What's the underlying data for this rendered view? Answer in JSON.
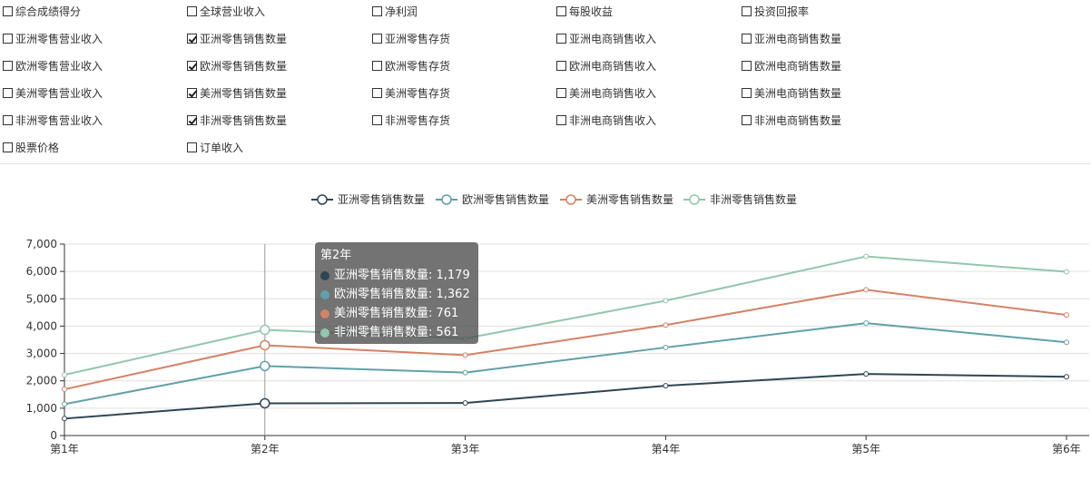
{
  "checkbox_rows": [
    [
      {
        "label": "综合成绩得分",
        "checked": false
      },
      {
        "label": "全球营业收入",
        "checked": false
      },
      {
        "label": "净利润",
        "checked": false
      },
      {
        "label": "每股收益",
        "checked": false
      },
      {
        "label": "投资回报率",
        "checked": false
      }
    ],
    [
      {
        "label": "亚洲零售营业收入",
        "checked": false
      },
      {
        "label": "亚洲零售销售数量",
        "checked": true
      },
      {
        "label": "亚洲零售存货",
        "checked": false
      },
      {
        "label": "亚洲电商销售收入",
        "checked": false
      },
      {
        "label": "亚洲电商销售数量",
        "checked": false
      }
    ],
    [
      {
        "label": "欧洲零售营业收入",
        "checked": false
      },
      {
        "label": "欧洲零售销售数量",
        "checked": true
      },
      {
        "label": "欧洲零售存货",
        "checked": false
      },
      {
        "label": "欧洲电商销售收入",
        "checked": false
      },
      {
        "label": "欧洲电商销售数量",
        "checked": false
      }
    ],
    [
      {
        "label": "美洲零售营业收入",
        "checked": false
      },
      {
        "label": "美洲零售销售数量",
        "checked": true
      },
      {
        "label": "美洲零售存货",
        "checked": false
      },
      {
        "label": "美洲电商销售收入",
        "checked": false
      },
      {
        "label": "美洲电商销售数量",
        "checked": false
      }
    ],
    [
      {
        "label": "非洲零售营业收入",
        "checked": false
      },
      {
        "label": "非洲零售销售数量",
        "checked": true
      },
      {
        "label": "非洲零售存货",
        "checked": false
      },
      {
        "label": "非洲电商销售收入",
        "checked": false
      },
      {
        "label": "非洲电商销售数量",
        "checked": false
      }
    ],
    [
      {
        "label": "股票价格",
        "checked": false
      },
      {
        "label": "订单收入",
        "checked": false
      }
    ]
  ],
  "chart_data": {
    "type": "line",
    "stacked": true,
    "categories": [
      "第1年",
      "第2年",
      "第3年",
      "第4年",
      "第5年",
      "第6年"
    ],
    "series": [
      {
        "name": "亚洲零售销售数量",
        "color": "#2f4554",
        "values": [
          620,
          1179,
          1190,
          1820,
          2250,
          2150
        ]
      },
      {
        "name": "欧洲零售销售数量",
        "color": "#61a0a8",
        "values": [
          530,
          1362,
          1110,
          1400,
          1860,
          1260
        ]
      },
      {
        "name": "美洲零售销售数量",
        "color": "#d48265",
        "values": [
          540,
          761,
          640,
          820,
          1220,
          1000
        ]
      },
      {
        "name": "非洲零售销售数量",
        "color": "#91c7ae",
        "values": [
          530,
          561,
          610,
          890,
          1220,
          1580
        ]
      }
    ],
    "ylim": [
      0,
      7000
    ],
    "yticks": [
      "0",
      "1,000",
      "2,000",
      "3,000",
      "4,000",
      "5,000",
      "6,000",
      "7,000"
    ],
    "grid": true,
    "legend_position": "top-center",
    "tooltip": {
      "title": "第2年",
      "category_index": 1,
      "rows": [
        {
          "text": "亚洲零售销售数量: 1,179",
          "color": "#2f4554"
        },
        {
          "text": "欧洲零售销售数量: 1,362",
          "color": "#61a0a8"
        },
        {
          "text": "美洲零售销售数量: 761",
          "color": "#d48265"
        },
        {
          "text": "非洲零售销售数量: 561",
          "color": "#91c7ae"
        }
      ]
    }
  }
}
